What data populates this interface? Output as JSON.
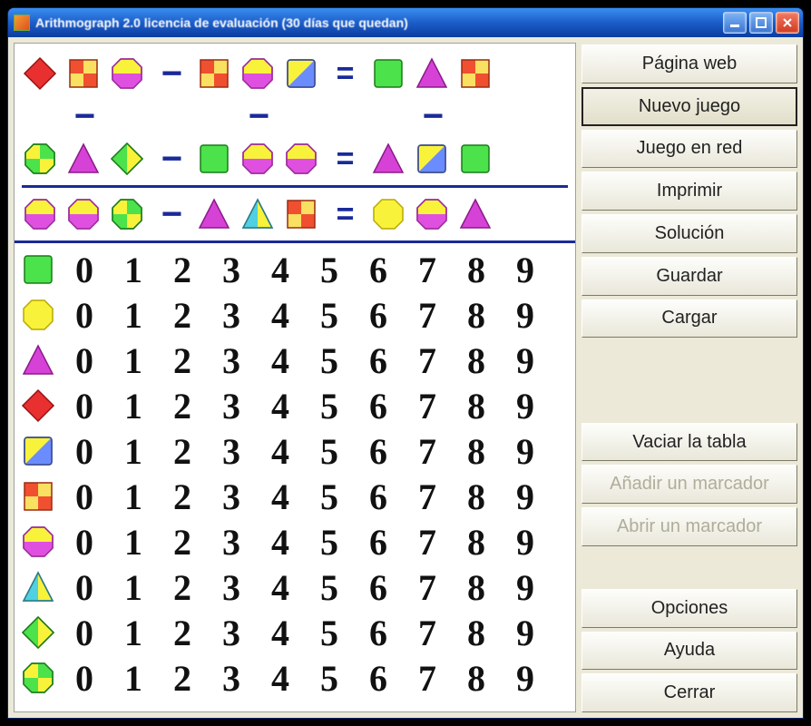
{
  "window": {
    "title": "Arithmograph 2.0 licencia de evaluación (30 días que quedan)"
  },
  "sidebar": {
    "buttons": [
      {
        "id": "pagina-web",
        "label": "Página web",
        "state": "normal"
      },
      {
        "id": "nuevo-juego",
        "label": "Nuevo juego",
        "state": "emphasis"
      },
      {
        "id": "juego-en-red",
        "label": "Juego en red",
        "state": "normal"
      },
      {
        "id": "imprimir",
        "label": "Imprimir",
        "state": "normal"
      },
      {
        "id": "solucion",
        "label": "Solución",
        "state": "normal"
      },
      {
        "id": "guardar",
        "label": "Guardar",
        "state": "normal"
      },
      {
        "id": "cargar",
        "label": "Cargar",
        "state": "normal"
      },
      {
        "id": "vaciar-tabla",
        "label": "Vaciar la tabla",
        "state": "normal"
      },
      {
        "id": "anadir-marcador",
        "label": "Añadir un marcador",
        "state": "disabled"
      },
      {
        "id": "abrir-marcador",
        "label": "Abrir un marcador",
        "state": "disabled"
      },
      {
        "id": "opciones",
        "label": "Opciones",
        "state": "normal"
      },
      {
        "id": "ayuda",
        "label": "Ayuda",
        "state": "normal"
      },
      {
        "id": "cerrar",
        "label": "Cerrar",
        "state": "normal"
      }
    ]
  },
  "shapes": {
    "green-square": {
      "kind": "square",
      "fill": "#4be24b",
      "stroke": "#1a7a1a"
    },
    "yellow-circle": {
      "kind": "octagon",
      "fill": "#f9f23a",
      "stroke": "#b8a800"
    },
    "magenta-triangle": {
      "kind": "triangle",
      "fill": "#d642d6",
      "stroke": "#8a1a8a"
    },
    "red-diamond": {
      "kind": "diamond",
      "fill": "#e83030",
      "stroke": "#9a1010"
    },
    "blue-yellow-square": {
      "kind": "square-diag",
      "fillA": "#6a8cff",
      "fillB": "#f9f23a",
      "stroke": "#3a4a8a"
    },
    "red-yellow-square": {
      "kind": "square-quad",
      "fillA": "#f05030",
      "fillB": "#f9e060",
      "stroke": "#9a2a10"
    },
    "magenta-yellow-circle": {
      "kind": "circle-half",
      "fillA": "#e050e0",
      "fillB": "#f9f23a",
      "stroke": "#9a2a9a"
    },
    "cyan-yellow-triangle": {
      "kind": "triangle-half",
      "fillA": "#50d0e0",
      "fillB": "#f9f23a",
      "stroke": "#2a7a8a"
    },
    "green-yellow-diamond": {
      "kind": "diamond-half",
      "fillA": "#4be24b",
      "fillB": "#f9f23a",
      "stroke": "#1a7a1a"
    },
    "green-yellow-circle": {
      "kind": "circle-quad",
      "fillA": "#4be24b",
      "fillB": "#f9f23a",
      "stroke": "#1a7a1a"
    }
  },
  "puzzle": {
    "rows": [
      {
        "left": [
          "red-diamond",
          "red-yellow-square",
          "magenta-yellow-circle"
        ],
        "op1": "−",
        "mid": [
          "red-yellow-square",
          "magenta-yellow-circle",
          "blue-yellow-square"
        ],
        "op2": "=",
        "right": [
          "green-square",
          "magenta-triangle",
          "red-yellow-square"
        ]
      },
      {
        "left": [
          "green-yellow-circle",
          "magenta-triangle",
          "green-yellow-diamond"
        ],
        "op1": "−",
        "mid": [
          "green-square",
          "magenta-yellow-circle",
          "magenta-yellow-circle"
        ],
        "op2": "=",
        "right": [
          "magenta-triangle",
          "blue-yellow-square",
          "green-square"
        ]
      },
      {
        "left": [
          "magenta-yellow-circle",
          "magenta-yellow-circle",
          "green-yellow-circle"
        ],
        "op1": "−",
        "mid": [
          "magenta-triangle",
          "cyan-yellow-triangle",
          "red-yellow-square"
        ],
        "op2": "=",
        "right": [
          "yellow-circle",
          "magenta-yellow-circle",
          "magenta-triangle"
        ]
      }
    ],
    "vertical_op": "−"
  },
  "table": {
    "shape_order": [
      "green-square",
      "yellow-circle",
      "magenta-triangle",
      "red-diamond",
      "blue-yellow-square",
      "red-yellow-square",
      "magenta-yellow-circle",
      "cyan-yellow-triangle",
      "green-yellow-diamond",
      "green-yellow-circle"
    ],
    "digits": [
      0,
      1,
      2,
      3,
      4,
      5,
      6,
      7,
      8,
      9
    ]
  }
}
